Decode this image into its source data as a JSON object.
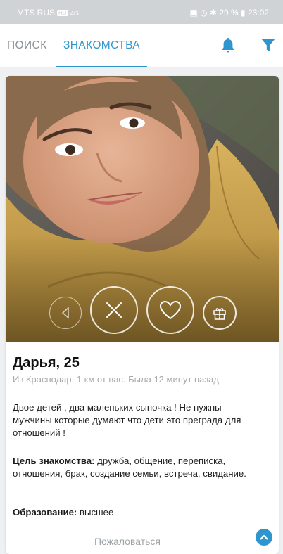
{
  "status_bar": {
    "carrier": "MTS RUS",
    "carrier_badge": "HD",
    "signal": "4G",
    "right": "29 %",
    "time": "23:02"
  },
  "nav": {
    "tabs": [
      "ПОИСК",
      "ЗНАКОМСТВА"
    ],
    "active_tab": "ЗНАКОМСТВА",
    "icons": [
      "bell-icon",
      "filter-icon"
    ],
    "accent_color": "#2f95cf"
  },
  "profile": {
    "name_age": "Дарья, 25",
    "meta": "Из Краснодар, 1 км от вас. Была 12 минут назад",
    "about": "Двое детей , два маленьких сыночка ! Не нужны мужчины которые думают что дети это преграда для отношений !",
    "goals_label": "Цель знакомства:",
    "goals_value": " дружба, общение, переписка, отношения, брак, создание семьи, встреча, свидание.",
    "education_label": "Образование:",
    "education_value": " высшее",
    "report": "Пожаловаться"
  },
  "actions": [
    "back-icon",
    "close-icon",
    "heart-icon",
    "gift-icon"
  ]
}
